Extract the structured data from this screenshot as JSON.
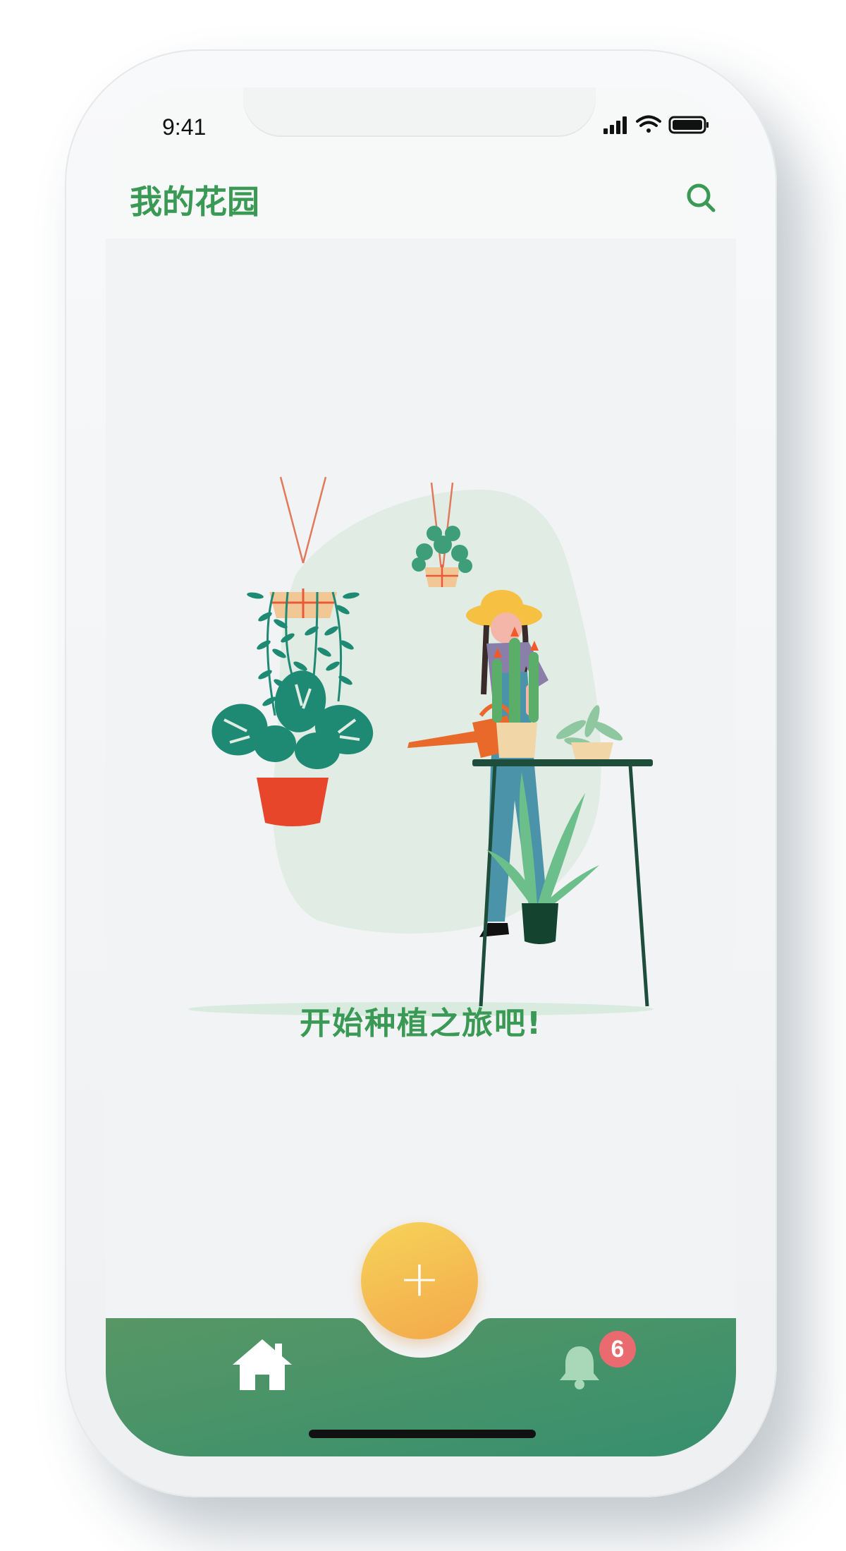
{
  "status_bar": {
    "time": "9:41"
  },
  "header": {
    "title": "我的花园",
    "search_icon": "search-icon"
  },
  "empty_state": {
    "message": "开始种植之旅吧!"
  },
  "fab": {
    "label": "+"
  },
  "tab_bar": {
    "home_icon": "home-icon",
    "bell_icon": "bell-icon",
    "notification_count": "6"
  },
  "colors": {
    "accent_green": "#3a9a55",
    "tab_bar_green": "#4a9868",
    "fab_yellow": "#f6d35a",
    "fab_orange": "#f3a84a",
    "badge_red": "#e96a6f"
  }
}
